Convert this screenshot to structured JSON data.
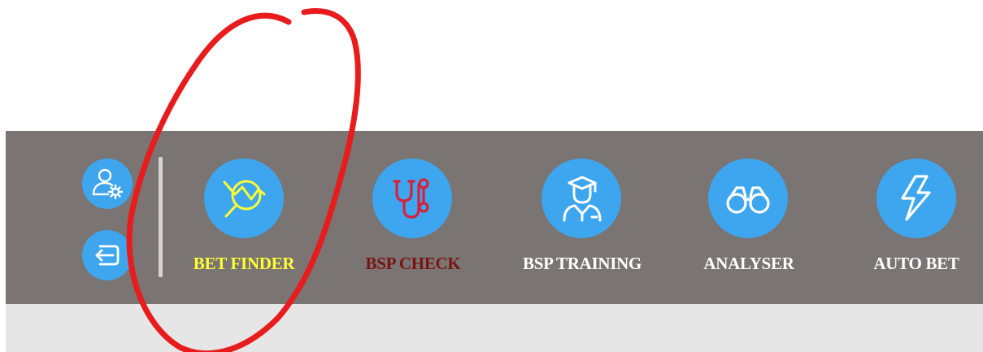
{
  "toolbar": {
    "account_settings_icon": "user-gear-icon",
    "logout_icon": "logout-icon",
    "items": [
      {
        "label": "BET FINDER",
        "icon": "chart-search-icon",
        "label_color": "#ffff33"
      },
      {
        "label": "BSP CHECK",
        "icon": "stethoscope-icon",
        "label_color": "#7a1414"
      },
      {
        "label": "BSP TRAINING",
        "icon": "graduate-icon",
        "label_color": "#ffffff"
      },
      {
        "label": "ANALYSER",
        "icon": "binoculars-icon",
        "label_color": "#ffffff"
      },
      {
        "label": "AUTO BET",
        "icon": "lightning-icon",
        "label_color": "#ffffff"
      }
    ]
  },
  "colors": {
    "toolbar_background": "#7a7472",
    "icon_circle": "#3ea5ef",
    "annotation_stroke": "#e81c1c"
  }
}
